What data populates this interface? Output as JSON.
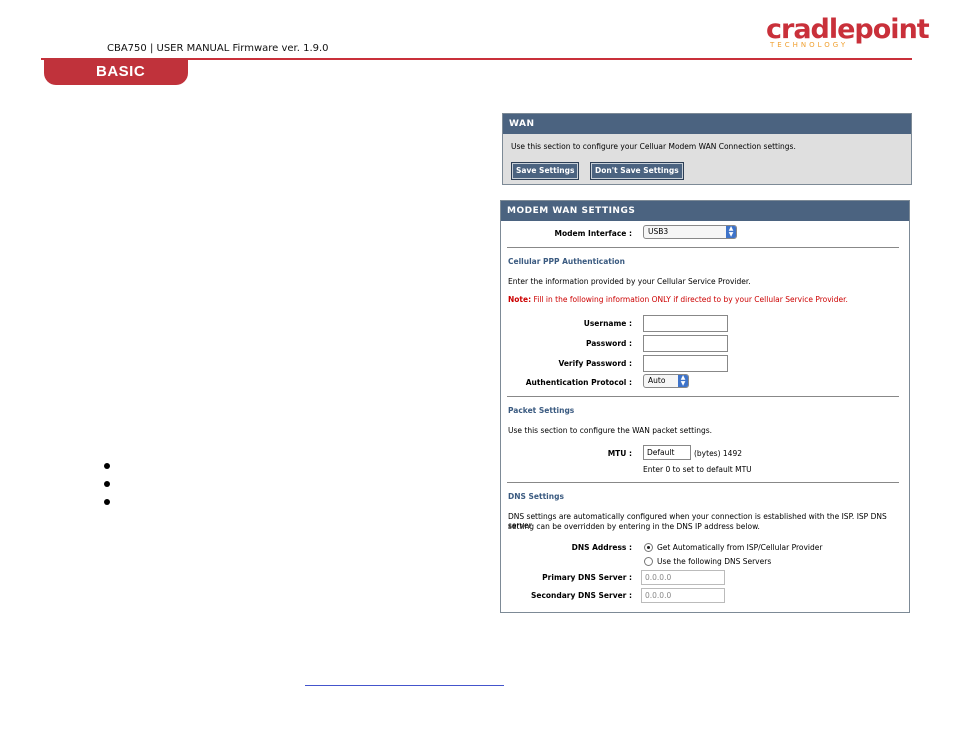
{
  "doc": {
    "header_text": "CBA750 | USER MANUAL Firmware ver. 1.9.0",
    "section_tab": "BASIC",
    "logo_text": "cradlepoint",
    "logo_subtext": "TECHNOLOGY"
  },
  "wan": {
    "title": "WAN",
    "description": "Use this section to configure your Celluar Modem WAN Connection settings.",
    "save_label": "Save Settings",
    "dont_save_label": "Don't Save Settings"
  },
  "modem": {
    "title": "MODEM WAN SETTINGS",
    "interface_label": "Modem Interface :",
    "interface_value": "USB3",
    "ppp": {
      "heading": "Cellular PPP Authentication",
      "intro": "Enter the information provided by your Cellular Service Provider.",
      "note_label": "Note:",
      "note_text": "Fill in the following information ONLY if directed to by your Cellular Service Provider.",
      "username_label": "Username :",
      "password_label": "Password :",
      "verify_label": "Verify Password :",
      "auth_label": "Authentication Protocol :",
      "auth_value": "Auto"
    },
    "packet": {
      "heading": "Packet Settings",
      "intro": "Use this section to configure the WAN packet settings.",
      "mtu_label": "MTU :",
      "mtu_value": "Default",
      "mtu_suffix": "(bytes) 1492",
      "mtu_hint": "Enter 0 to set to default MTU"
    },
    "dns": {
      "heading": "DNS Settings",
      "intro_line1": "DNS settings are automatically configured when your connection is established with the ISP. ISP DNS server",
      "intro_line2": "setting can be overridden by entering in the DNS IP address below.",
      "address_label": "DNS Address :",
      "option_auto": "Get Automatically from ISP/Cellular Provider",
      "option_manual": "Use the following DNS Servers",
      "primary_label": "Primary DNS Server :",
      "primary_value": "0.0.0.0",
      "secondary_label": "Secondary DNS Server :",
      "secondary_value": "0.0.0.0"
    }
  }
}
